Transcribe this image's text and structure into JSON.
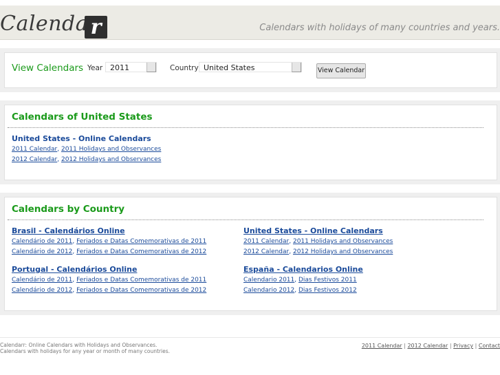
{
  "header": {
    "logo_text": "Calendar",
    "logo_letter": "r",
    "tagline": "Calendars with holidays of many countries and years."
  },
  "view_form": {
    "title": "View Calendars",
    "year_label": "Year",
    "year_value": "2011",
    "country_label": "Country",
    "country_value": "United States",
    "button_label": "View Calendar"
  },
  "us_panel": {
    "title": "Calendars of United States",
    "subtitle": "United States - Online Calendars",
    "rows": [
      [
        "2011 Calendar",
        "2011 Holidays and Observances"
      ],
      [
        "2012 Calendar",
        "2012 Holidays and Observances"
      ]
    ]
  },
  "country_panel": {
    "title": "Calendars by Country",
    "left": [
      {
        "title": "Brasil - Calendários Online",
        "rows": [
          [
            "Calendário de 2011",
            "Feriados e Datas Comemorativas de 2011"
          ],
          [
            "Calendário de 2012",
            "Feriados e Datas Comemorativas de 2012"
          ]
        ]
      },
      {
        "title": "Portugal - Calendários Online",
        "rows": [
          [
            "Calendário de 2011",
            "Feriados e Datas Comemorativas de 2011"
          ],
          [
            "Calendário de 2012",
            "Feriados e Datas Comemorativas de 2012"
          ]
        ]
      }
    ],
    "right": [
      {
        "title": "United States - Online Calendars",
        "rows": [
          [
            "2011 Calendar",
            "2011 Holidays and Observances"
          ],
          [
            "2012 Calendar",
            "2012 Holidays and Observances"
          ]
        ]
      },
      {
        "title": "España - Calendarios Online",
        "rows": [
          [
            "Calendario 2011",
            "Dias Festivos 2011"
          ],
          [
            "Calendario 2012",
            "Dias Festivos 2012"
          ]
        ]
      }
    ]
  },
  "footer": {
    "line1": "Calendarr: Online Calendars with Holidays and Observances.",
    "line2": "Calendars with holidays for any year or month of many countries.",
    "links": [
      "2011 Calendar",
      "2012 Calendar",
      "Privacy",
      "Contact"
    ]
  }
}
